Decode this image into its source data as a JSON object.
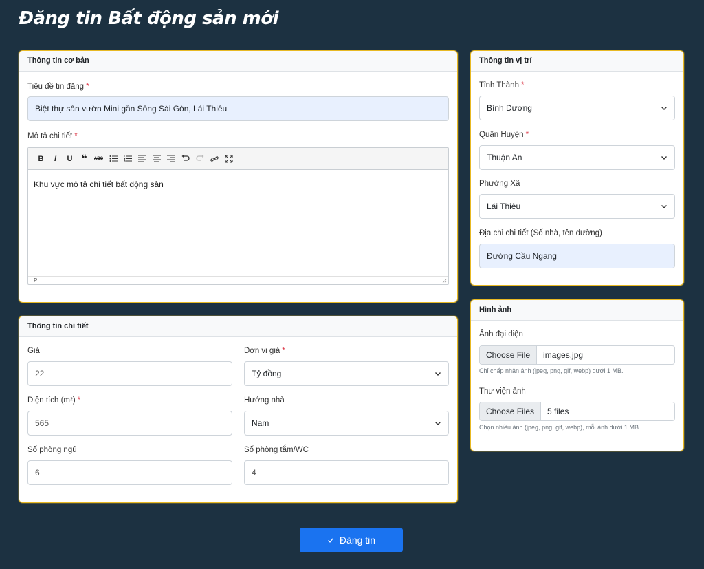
{
  "page": {
    "title": "Đăng tin Bất động sản mới"
  },
  "basic": {
    "header": "Thông tin cơ bản",
    "title_label": "Tiêu đề tin đăng",
    "title_value": "Biệt thự sân vườn Mini gần Sông Sài Gòn, Lái Thiêu",
    "desc_label": "Mô tả chi tiết",
    "desc_content": "Khu vực mô tả chi tiết bất động sản",
    "editor_status": "P",
    "toolbar": [
      "B",
      "I",
      "U",
      "❝",
      "ABC",
      "bullet-list",
      "numbered-list",
      "align-left",
      "align-center",
      "align-right",
      "undo",
      "redo",
      "link",
      "fullscreen"
    ]
  },
  "details": {
    "header": "Thông tin chi tiết",
    "price_label": "Giá",
    "price_value": "22",
    "unit_label": "Đơn vị giá",
    "unit_value": "Tỷ đồng",
    "area_label": "Diện tích (m²)",
    "area_value": "565",
    "direction_label": "Hướng nhà",
    "direction_value": "Nam",
    "bedrooms_label": "Số phòng ngủ",
    "bedrooms_value": "6",
    "bathrooms_label": "Số phòng tắm/WC",
    "bathrooms_value": "4"
  },
  "location": {
    "header": "Thông tin vị trí",
    "province_label": "Tỉnh Thành",
    "province_value": "Bình Dương",
    "district_label": "Quận Huyện",
    "district_value": "Thuận An",
    "ward_label": "Phường Xã",
    "ward_value": "Lái Thiêu",
    "address_label": "Địa chỉ chi tiết (Số nhà, tên đường)",
    "address_value": "Đường Cầu Ngang"
  },
  "images": {
    "header": "Hình ảnh",
    "avatar_label": "Ảnh đại diện",
    "avatar_button": "Choose File",
    "avatar_file": "images.jpg",
    "avatar_hint": "Chỉ chấp nhận ảnh (jpeg, png, gif, webp) dưới 1 MB.",
    "gallery_label": "Thư viện ảnh",
    "gallery_button": "Choose Files",
    "gallery_files": "5 files",
    "gallery_hint": "Chọn nhiều ảnh (jpeg, png, gif, webp), mỗi ảnh dưới 1 MB."
  },
  "submit": {
    "label": "Đăng tin"
  },
  "colors": {
    "background": "#1c3141",
    "card_border": "#e8b923",
    "primary": "#1a73f0",
    "filled_input": "#e8f0fe",
    "required": "#dc3545"
  }
}
